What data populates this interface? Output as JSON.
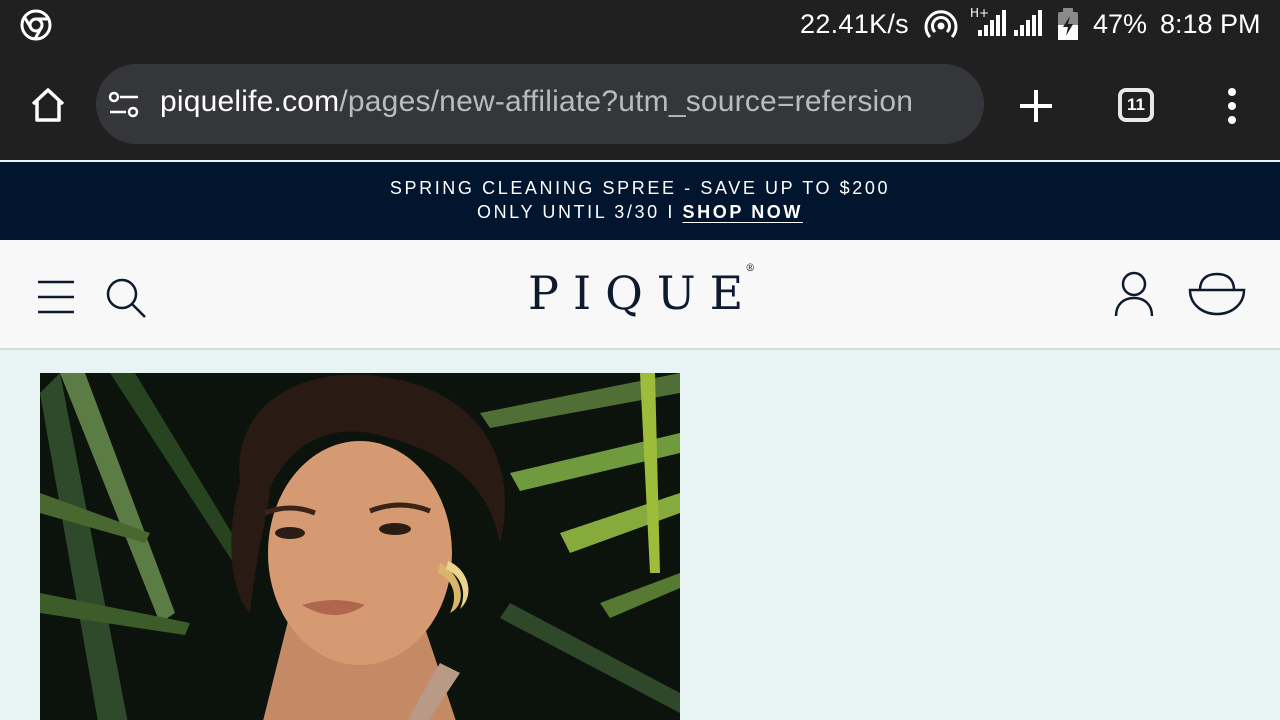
{
  "status_bar": {
    "net_speed": "22.41K/s",
    "battery": "47%",
    "time": "8:18 PM",
    "network_type": "H+"
  },
  "browser": {
    "url_domain": "piquelife.com",
    "url_path": "/pages/new-affiliate?utm_source=refersion",
    "tab_count": "11"
  },
  "promo": {
    "line1": "SPRING CLEANING SPREE - SAVE UP TO $200",
    "line2": "ONLY UNTIL 3/30 I ",
    "cta": "SHOP NOW"
  },
  "site": {
    "logo": "PIQUE",
    "logo_mark": "®"
  },
  "colors": {
    "chrome_bg": "#202020",
    "banner_bg": "#01152f",
    "header_bg": "#f8f8f8",
    "page_bg": "#e8f3f3",
    "brand_navy": "#0e1a2e"
  },
  "icons": {
    "status": [
      "chrome-icon",
      "hotspot-icon",
      "signal-icon",
      "battery-icon"
    ],
    "toolbar": [
      "home-icon",
      "site-settings-icon",
      "plus-icon",
      "tab-switcher-icon",
      "more-vert-icon"
    ],
    "header": [
      "menu-icon",
      "search-icon",
      "account-icon",
      "cart-icon"
    ]
  }
}
